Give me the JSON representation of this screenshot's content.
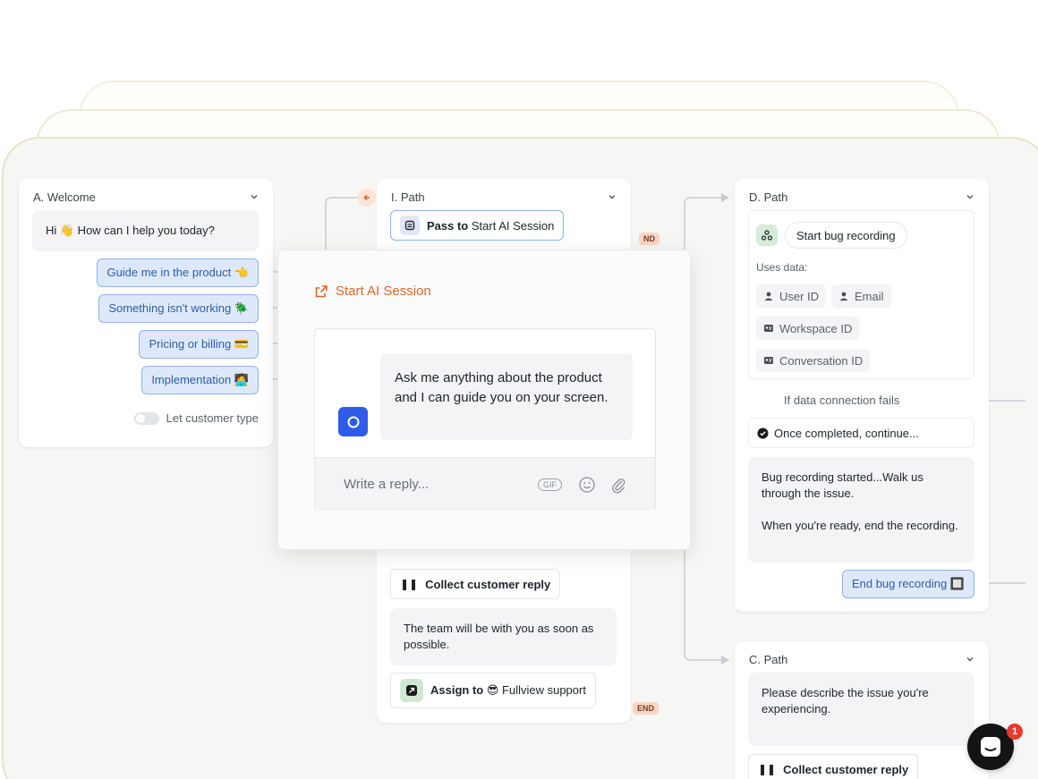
{
  "nodes": {
    "welcome": {
      "header": "A. Welcome",
      "greeting": "Hi 👋 How can I help you today?",
      "options": [
        "Guide me in the product 👈",
        "Something isn't working 🪲",
        "Pricing or billing 💳",
        "Implementation 🧑‍💻"
      ],
      "toggle_label": "Let customer type"
    },
    "path_i": {
      "header": "I. Path",
      "pass_prefix": "Pass to",
      "pass_target": "Start AI Session",
      "collect_label": "Collect customer reply",
      "team_message": "The team will be with you as soon as possible.",
      "assign_prefix": "Assign to",
      "assign_target": "😎 Fullview support",
      "end_label": "END",
      "end_label_top": "ND"
    },
    "path_d": {
      "header": "D. Path",
      "bug_btn": "Start bug recording",
      "uses_data": "Uses data:",
      "chips": [
        "User ID",
        "Email",
        "Workspace ID",
        "Conversation ID"
      ],
      "fail_label": "If data connection fails",
      "completed_label": "Once completed, continue...",
      "message_line1": "Bug recording started...Walk us through the issue.",
      "message_line2": "When you're ready, end the recording.",
      "end_btn": "End bug recording 🔲"
    },
    "path_c": {
      "header": "C. Path",
      "message": "Please describe the issue you're experiencing.",
      "collect_label": "Collect customer reply"
    }
  },
  "modal": {
    "title": "Start AI Session",
    "bot_message": "Ask me anything about the product and I can guide you on your screen.",
    "reply_placeholder": "Write a reply...",
    "gif_label": "GIF"
  },
  "launcher": {
    "badge_count": "1"
  },
  "colors": {
    "accent_orange": "#e0662a",
    "option_blue_bg": "#dde9fb",
    "option_blue_border": "#8fb3ea",
    "bot_avatar": "#2f5bea"
  }
}
